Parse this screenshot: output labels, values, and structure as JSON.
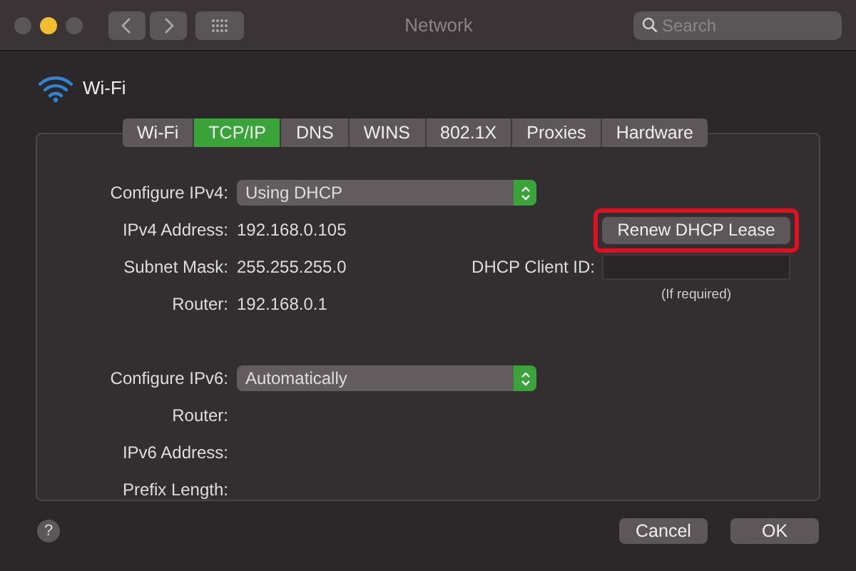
{
  "window": {
    "title": "Network",
    "traffic_lights": [
      {
        "color": "#5b5657"
      },
      {
        "color": "#f3bd2e"
      },
      {
        "color": "#5b5657"
      }
    ],
    "search": {
      "placeholder": "Search"
    }
  },
  "interface": {
    "name": "Wi-Fi"
  },
  "tabs": [
    {
      "label": "Wi-Fi",
      "selected": false
    },
    {
      "label": "TCP/IP",
      "selected": true
    },
    {
      "label": "DNS",
      "selected": false
    },
    {
      "label": "WINS",
      "selected": false
    },
    {
      "label": "802.1X",
      "selected": false
    },
    {
      "label": "Proxies",
      "selected": false
    },
    {
      "label": "Hardware",
      "selected": false
    }
  ],
  "ipv4": [
    {
      "label": "Configure IPv4:",
      "kind": "select",
      "value": "Using DHCP"
    },
    {
      "label": "IPv4 Address:",
      "kind": "text",
      "value": "192.168.0.105"
    },
    {
      "label": "Subnet Mask:",
      "kind": "text",
      "value": "255.255.255.0"
    },
    {
      "label": "Router:",
      "kind": "text",
      "value": "192.168.0.1"
    }
  ],
  "dhcp": {
    "renew_button": {
      "label": "Renew DHCP Lease",
      "highlighted": true
    },
    "client_id_label": "DHCP Client ID:",
    "client_id_note": "(If required)"
  },
  "ipv6": [
    {
      "label": "Configure IPv6:",
      "kind": "select",
      "value": "Automatically"
    },
    {
      "label": "Router:",
      "kind": "text"
    },
    {
      "label": "IPv6 Address:",
      "kind": "text"
    },
    {
      "label": "Prefix Length:",
      "kind": "text"
    }
  ],
  "footer": {
    "help": "?",
    "buttons": [
      "Cancel",
      "OK"
    ]
  }
}
